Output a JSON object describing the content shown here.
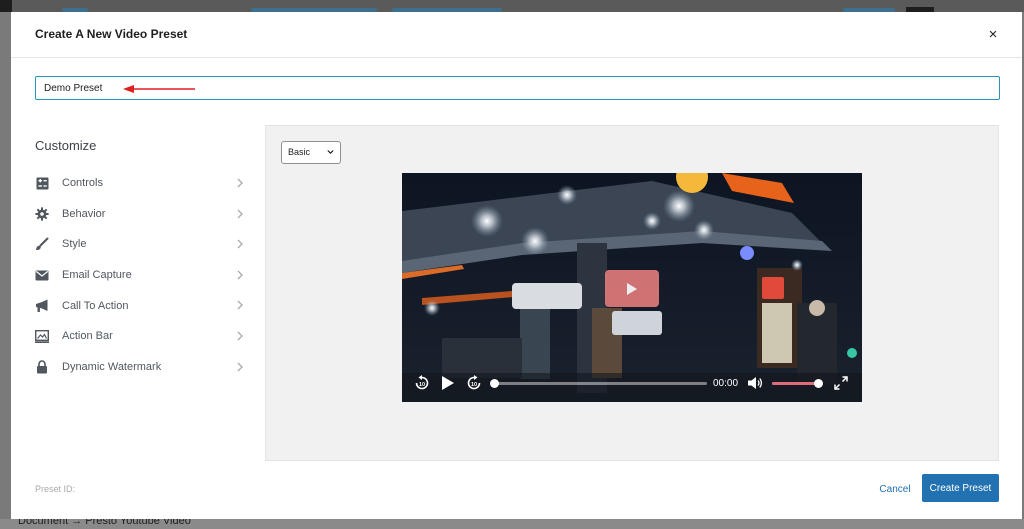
{
  "modal": {
    "title": "Create A New Video Preset",
    "close_label": "×"
  },
  "preset_name": {
    "value": "Demo Preset"
  },
  "sidebar": {
    "title": "Customize",
    "items": [
      {
        "label": "Controls",
        "icon": "controls-icon"
      },
      {
        "label": "Behavior",
        "icon": "gear-icon"
      },
      {
        "label": "Style",
        "icon": "brush-icon"
      },
      {
        "label": "Email Capture",
        "icon": "envelope-icon"
      },
      {
        "label": "Call To Action",
        "icon": "megaphone-icon"
      },
      {
        "label": "Action Bar",
        "icon": "action-bar-icon"
      },
      {
        "label": "Dynamic Watermark",
        "icon": "lock-icon"
      }
    ]
  },
  "preview": {
    "skin_select": "Basic",
    "time": "00:00",
    "volume_level": 0.95,
    "progress_level": 0
  },
  "footer": {
    "preset_id_label": "Preset ID:",
    "cancel_label": "Cancel",
    "create_label": "Create Preset"
  },
  "background_page": {
    "breadcrumb": "Document → Presto Youtube Video"
  },
  "colors": {
    "primary": "#2271b1",
    "input_focus": "#2b95b4",
    "arrow": "#e02020",
    "play_button": "#e07a7a",
    "volume_fill": "#e06b7a"
  }
}
